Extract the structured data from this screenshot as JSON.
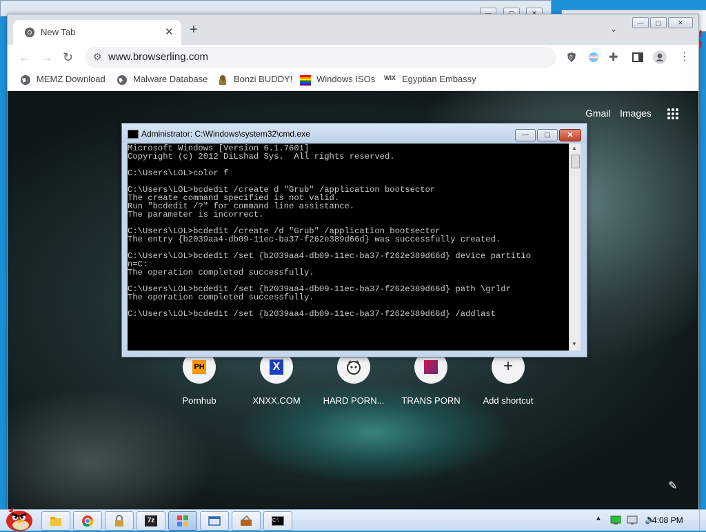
{
  "chrome": {
    "tab_title": "New Tab",
    "tab_close": "✕",
    "new_tab": "+",
    "tab_search": "⌄",
    "url": "www.browserling.com",
    "bookmarks": [
      "MEMZ Download",
      "Malware Database",
      "Bonzi BUDDY!",
      "Windows ISOs",
      "Egyptian Embassy"
    ],
    "window_controls": [
      "—",
      "▢",
      "✕"
    ]
  },
  "newtab": {
    "links": [
      "Gmail",
      "Images"
    ],
    "shortcuts": [
      {
        "label": "Pornhub",
        "icon": "PH"
      },
      {
        "label": "XNXX.COM",
        "icon": "X"
      },
      {
        "label": "HARD PORN...",
        "icon": "dog-logo-icon"
      },
      {
        "label": "TRANS PORN",
        "icon": "trans-porn-icon"
      },
      {
        "label": "Add shortcut",
        "icon": "+"
      }
    ],
    "edit_icon": "✎"
  },
  "cmd": {
    "title": "Administrator: C:\\Windows\\system32\\cmd.exe",
    "lines": [
      "Microsoft Windows [Version 6.1.7601]",
      "Copyright (c) 2012 DiLshad Sys.  All rights reserved.",
      "",
      "C:\\Users\\LOL>color f",
      "",
      "C:\\Users\\LOL>bcdedit /create d \"Grub\" /application bootsector",
      "The create command specified is not valid.",
      "Run \"bcdedit /?\" for command line assistance.",
      "The parameter is incorrect.",
      "",
      "C:\\Users\\LOL>bcdedit /create /d \"Grub\" /application bootsector",
      "The entry {b2039aa4-db09-11ec-ba37-f262e389d66d} was successfully created.",
      "",
      "C:\\Users\\LOL>bcdedit /set {b2039aa4-db09-11ec-ba37-f262e389d66d} device partitio",
      "n=C:",
      "The operation completed successfully.",
      "",
      "C:\\Users\\LOL>bcdedit /set {b2039aa4-db09-11ec-ba37-f262e389d66d} path \\grldr",
      "The operation completed successfully.",
      "",
      "C:\\Users\\LOL>bcdedit /set {b2039aa4-db09-11ec-ba37-f262e389d66d} /addlast"
    ]
  },
  "taskbar": {
    "clock": "4:08 PM",
    "icons": [
      "explorer-icon",
      "chrome-icon",
      "lock-icon",
      "7zip-icon",
      "app-grid-icon",
      "window-icon",
      "toolbox-icon",
      "cmd-icon"
    ]
  },
  "colors": {
    "desktop": "#1e90d8",
    "console_bg": "#000000",
    "console_text": "#c8c8c8"
  }
}
